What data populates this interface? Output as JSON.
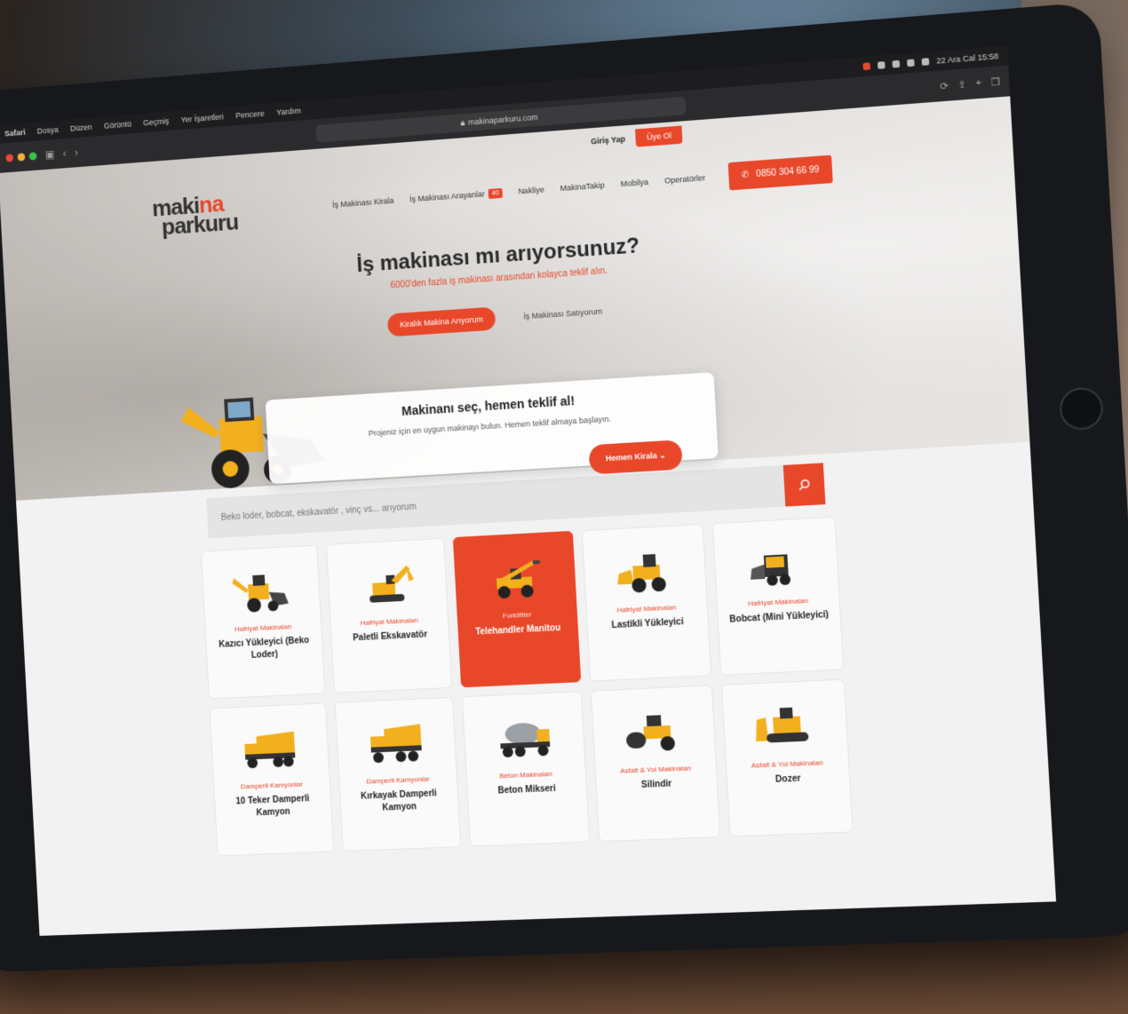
{
  "menubar": {
    "items": [
      "Safari",
      "Dosya",
      "Düzen",
      "Görüntü",
      "Geçmiş",
      "Yer İşaretleri",
      "Pencere",
      "Yardım"
    ],
    "clock": "22 Ara Cal 15:58"
  },
  "browser": {
    "url": "makinaparkuru.com"
  },
  "site": {
    "login": "Giriş Yap",
    "signup": "Üye Ol",
    "logo": {
      "line1_a": "maki",
      "line1_b": "na",
      "line2": "parkuru"
    },
    "nav": [
      {
        "label": "İş Makinası Kirala"
      },
      {
        "label": "İş Makinası Arayanlar",
        "badge": "40"
      },
      {
        "label": "Nakliye"
      },
      {
        "label": "MakinaTakip"
      },
      {
        "label": "Mobilya"
      },
      {
        "label": "Operatörler"
      }
    ],
    "phone": "0850 304 66 99",
    "hero": {
      "title": "İş makinası mı arıyorsunuz?",
      "subtitle": "6000'den fazla iş makinası arasından kolayca teklif alın.",
      "tabs": [
        "Kiralık Makina Arıyorum",
        "İş Makinası Satıyorum"
      ]
    },
    "offer": {
      "title": "Makinanı seç, hemen teklif al!",
      "text": "Projeniz için en uygun makinayı bulun. Hemen teklif almaya başlayın.",
      "button": "Hemen Kirala"
    },
    "search": {
      "placeholder": "Beko loder, bobcat, ekskavatör , vinç vs... arıyorum"
    },
    "categories": [
      {
        "cat": "Hafriyat Makinaları",
        "name": "Kazıcı Yükleyici (Beko Loder)",
        "icon": "backhoe-loader",
        "active": false
      },
      {
        "cat": "Hafriyat Makinaları",
        "name": "Paletli Ekskavatör",
        "icon": "excavator",
        "active": false
      },
      {
        "cat": "Forkliftler",
        "name": "Telehandler Manitou",
        "icon": "telehandler",
        "active": true
      },
      {
        "cat": "Hafriyat Makinaları",
        "name": "Lastikli Yükleyici",
        "icon": "wheel-loader",
        "active": false
      },
      {
        "cat": "Hafriyat Makinaları",
        "name": "Bobcat (Mini Yükleyici)",
        "icon": "skid-steer",
        "active": false
      },
      {
        "cat": "Damperli Kamyonlar",
        "name": "10 Teker Damperli Kamyon",
        "icon": "dump-truck",
        "active": false
      },
      {
        "cat": "Damperli Kamyonlar",
        "name": "Kırkayak Damperli Kamyon",
        "icon": "dump-truck",
        "active": false
      },
      {
        "cat": "Beton Makinaları",
        "name": "Beton Mikseri",
        "icon": "concrete-mixer",
        "active": false
      },
      {
        "cat": "Asfalt & Yol Makinaları",
        "name": "Silindir",
        "icon": "road-roller",
        "active": false
      },
      {
        "cat": "Asfalt & Yol Makinaları",
        "name": "Dozer",
        "icon": "bulldozer",
        "active": false
      }
    ]
  },
  "colors": {
    "accent": "#e8472a",
    "machine": "#f2b01e",
    "dark": "#222222"
  }
}
